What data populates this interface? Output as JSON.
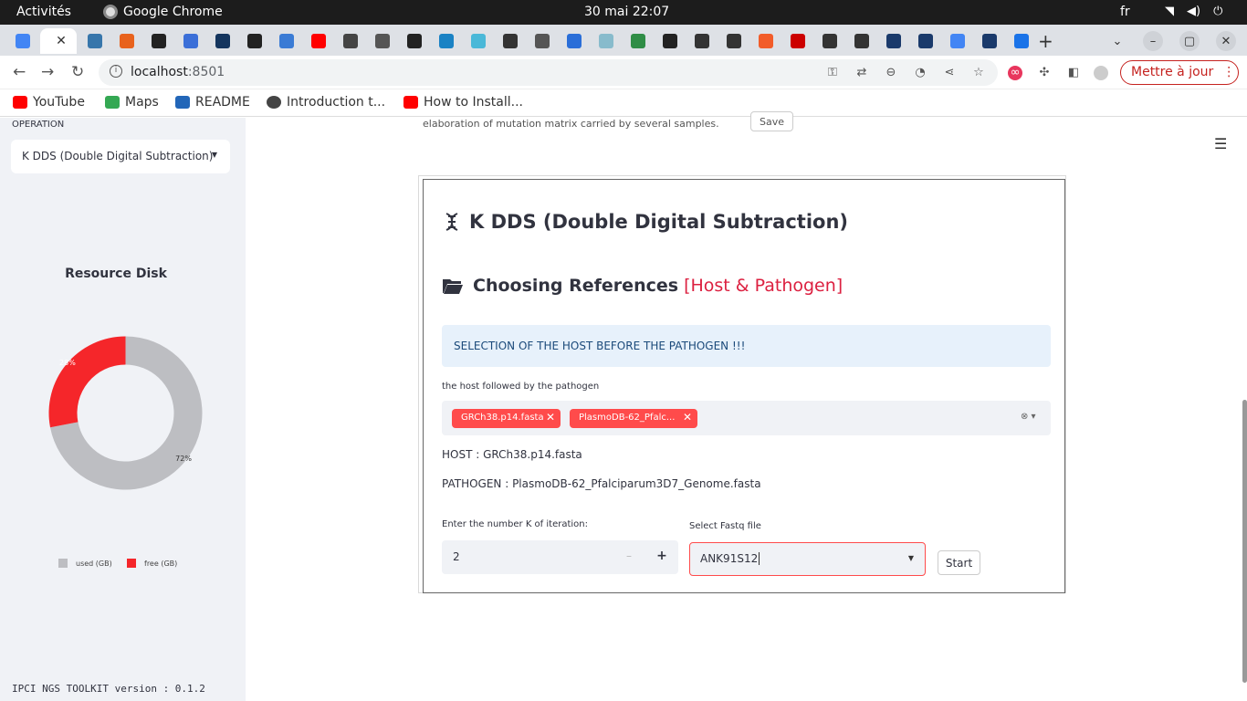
{
  "os_bar": {
    "activities": "Activités",
    "app_name": "Google Chrome",
    "clock": "30 mai  22:07",
    "language": "fr"
  },
  "browser": {
    "url_host": "localhost",
    "url_port": ":8501",
    "update_button": "Mettre à jour",
    "bookmarks": [
      "YouTube",
      "Maps",
      "README",
      "Introduction t...",
      "How to Install..."
    ]
  },
  "sidebar": {
    "operation_label": "OPERATION",
    "operation_value": "K DDS (Double Digital Subtraction)",
    "disk_title": "Resource Disk",
    "disk_chart": {
      "type": "pie",
      "series": [
        {
          "name": "used (GB)",
          "percent": 72,
          "label": "72%",
          "color": "#bdbec2"
        },
        {
          "name": "free (GB)",
          "percent": 28,
          "label": "28%",
          "color": "#f5262a"
        }
      ]
    },
    "legend_used": "used (GB)",
    "legend_free": "free (GB)",
    "version": "IPCI NGS TOOLKIT version : 0.1.2"
  },
  "main": {
    "top_text": "elaboration of mutation matrix carried by several samples.",
    "save_button": "Save",
    "card": {
      "title": "K DDS (Double Digital Subtraction)",
      "subtitle": "Choosing References",
      "subtitle_accent": "[Host & Pathogen]",
      "info": "SELECTION OF THE HOST BEFORE THE PATHOGEN !!!",
      "multiselect_label": "the host followed by the pathogen",
      "chips": [
        "GRCh38.p14.fasta",
        "PlasmoDB-62_Pfalc..."
      ],
      "host_line": "HOST : GRCh38.p14.fasta",
      "pathogen_line": "PATHOGEN : PlasmoDB-62_Pfalciparum3D7_Genome.fasta",
      "k_label": "Enter the number K of iteration:",
      "k_value": "2",
      "fastq_label": "Select Fastq file",
      "fastq_value": "ANK91S12",
      "start_button": "Start"
    }
  },
  "colors": {
    "accent": "#ff4b4b",
    "sidebar_bg": "#f0f2f6",
    "info_bg": "#e7f1fb"
  }
}
